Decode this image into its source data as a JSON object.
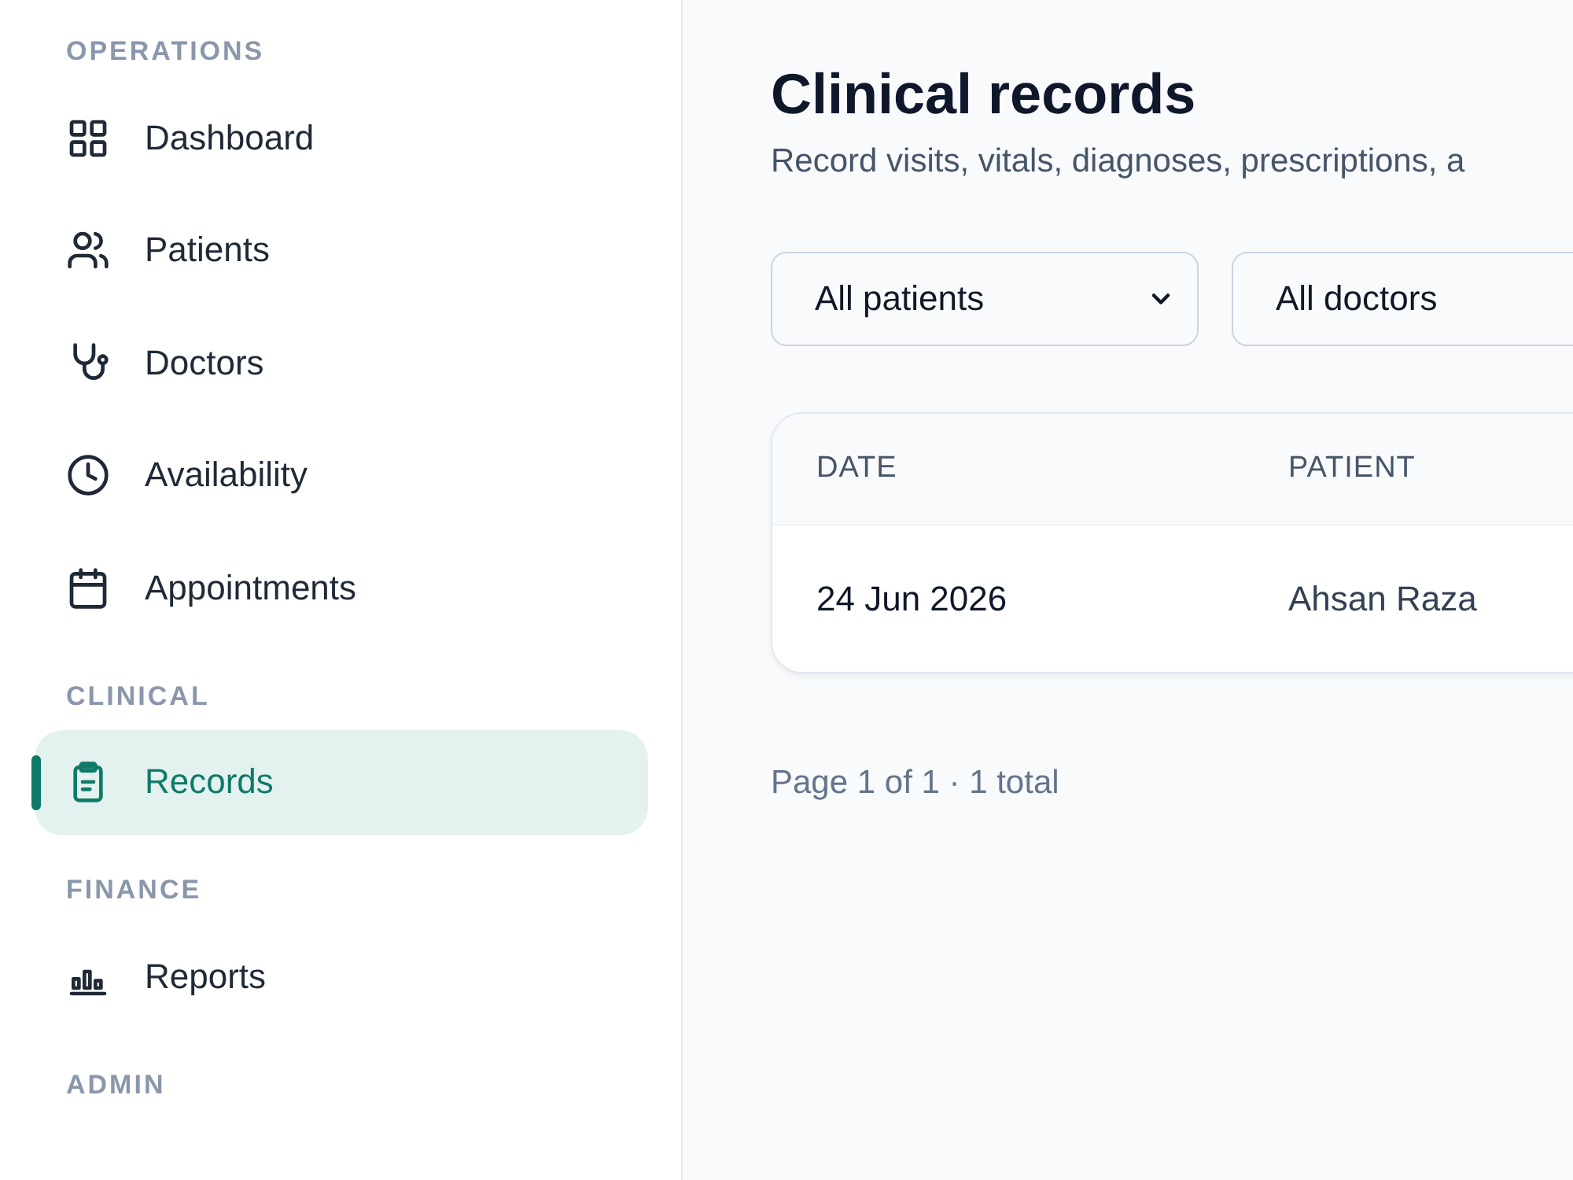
{
  "sidebar": {
    "sections": [
      {
        "heading": "OPERATIONS",
        "items": [
          {
            "label": "Dashboard",
            "kind": "grid",
            "selected": false
          },
          {
            "label": "Patients",
            "kind": "users",
            "selected": false
          },
          {
            "label": "Doctors",
            "kind": "stethoscope",
            "selected": false
          },
          {
            "label": "Availability",
            "kind": "clock",
            "selected": false
          },
          {
            "label": "Appointments",
            "kind": "calendar",
            "selected": false
          }
        ]
      },
      {
        "heading": "CLINICAL",
        "items": [
          {
            "label": "Records",
            "kind": "clipboard",
            "selected": true
          }
        ]
      },
      {
        "heading": "FINANCE",
        "items": [
          {
            "label": "Reports",
            "kind": "chart",
            "selected": false
          }
        ]
      },
      {
        "heading": "ADMIN"
      }
    ]
  },
  "page": {
    "title": "Clinical records",
    "subtitle": "Record visits, vitals, diagnoses, prescriptions, a"
  },
  "filters": [
    {
      "value": "All patients",
      "chevron": true
    },
    {
      "value": "All doctors",
      "chevron": false
    }
  ],
  "table": {
    "columns": [
      "DATE",
      "PATIENT"
    ],
    "rows": [
      [
        "24 Jun 2026",
        "Ahsan Raza"
      ]
    ]
  },
  "pagination": "Page 1 of 1 · 1 total"
}
